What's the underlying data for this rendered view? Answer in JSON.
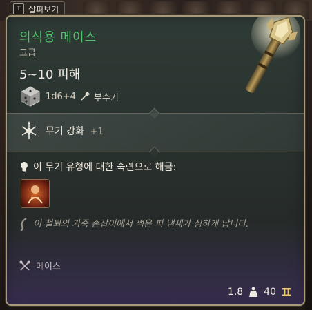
{
  "peek_tab": {
    "key": "T",
    "label": "살펴보기"
  },
  "item": {
    "name": "의식용 메이스",
    "rarity": "고급",
    "damage": "5~10 피해",
    "dice": "1d6+4",
    "damage_type": "부수기",
    "name_color": "#4fc36b"
  },
  "enchant": {
    "label": "무기 강화",
    "value": "+1"
  },
  "proficiency": {
    "text": "이 무기 유형에 대한 숙련으로 해금:"
  },
  "flavor": {
    "text": "이 철퇴의 가죽 손잡이에서 썩은 피 냄새가 심하게 납니다."
  },
  "weapon_type": {
    "label": "메이스"
  },
  "footer": {
    "weight": "1.8",
    "value": "40"
  },
  "icons": {
    "dice": "d6-dice-icon",
    "damage_type": "bludgeon-icon",
    "enchant": "weapon-enchant-icon",
    "proficiency": "lightbulb-icon",
    "skill": "weapon-action-icon",
    "flavor": "quill-icon",
    "weapon_type": "crossed-maces-icon",
    "weight": "weight-icon",
    "gold": "gold-icon"
  }
}
